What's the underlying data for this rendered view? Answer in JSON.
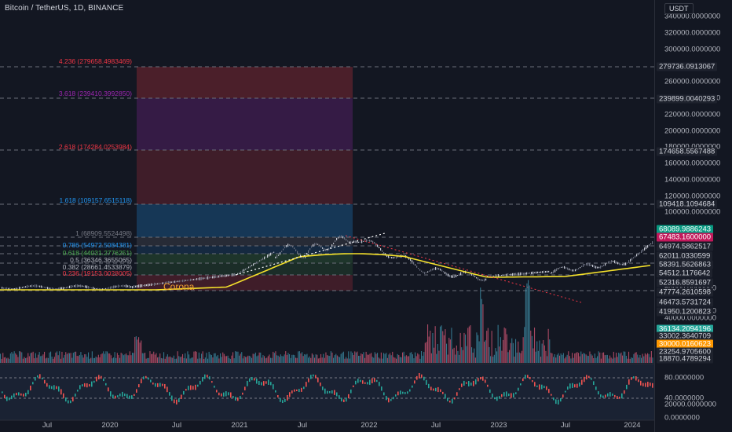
{
  "header": {
    "title": "Bitcoin / TetherUS, 1D, BINANCE",
    "currency_button": "USDT"
  },
  "annotation": {
    "text": "Corona",
    "color": "#f0a030"
  },
  "fib_levels": [
    {
      "label": "4.236 (279658.4983469)",
      "color": "#f23645"
    },
    {
      "label": "3.618 (239410.3992850)",
      "color": "#9c27b0"
    },
    {
      "label": "2.618 (174284.0253984)",
      "color": "#f23645"
    },
    {
      "label": "1.618 (109157.6515118)",
      "color": "#2196f3"
    },
    {
      "label": "1 (68909.5524498)",
      "color": "#787b86"
    },
    {
      "label": "0.786 (54972.5084381)",
      "color": "#2196f3"
    },
    {
      "label": "0.618 (44031.2776251)",
      "color": "#4caf50"
    },
    {
      "label": "0.5 (36346.3655065)",
      "color": "#b2b5be"
    },
    {
      "label": "0.382 (28661.4533879)",
      "color": "#b2b5be"
    },
    {
      "label": "0.236 (19153.0028005)",
      "color": "#f23645"
    }
  ],
  "price_axis": {
    "labels": [
      "340000.0000000",
      "320000.0000000",
      "300000.0000000",
      "260000.0000000",
      "240000.0000000",
      "220000.0000000",
      "200000.0000000",
      "180000.0000000",
      "160000.0000000",
      "140000.0000000",
      "120000.0000000",
      "100000.0000000",
      "50000.0000000",
      "45000.0000000",
      "40000.0000000",
      "20000.0000000"
    ],
    "badges": [
      {
        "text": "279736.0913067",
        "bg": "#1e222d",
        "fg": "#d1d4dc"
      },
      {
        "text": "239899.0040293",
        "bg": "#1e222d",
        "fg": "#d1d4dc"
      },
      {
        "text": "174658.5567488",
        "bg": "#1e222d",
        "fg": "#d1d4dc"
      },
      {
        "text": "109418.1094684",
        "bg": "#1e222d",
        "fg": "#d1d4dc"
      },
      {
        "text": "68089.9886243",
        "bg": "#089981",
        "fg": "#ffffff"
      },
      {
        "text": "67483.1600000",
        "bg": "#c2185b",
        "fg": "#ffffff"
      },
      {
        "text": "64974.5862517",
        "bg": "#1e222d",
        "fg": "#d1d4dc"
      },
      {
        "text": "62011.0330599",
        "bg": "#1e222d",
        "fg": "#d1d4dc"
      },
      {
        "text": "58391.5626863",
        "bg": "#1e222d",
        "fg": "#d1d4dc"
      },
      {
        "text": "54512.1176642",
        "bg": "#1e222d",
        "fg": "#d1d4dc"
      },
      {
        "text": "52316.8591697",
        "bg": "#1e222d",
        "fg": "#d1d4dc"
      },
      {
        "text": "47774.2610598",
        "bg": "#1e222d",
        "fg": "#d1d4dc"
      },
      {
        "text": "46473.5731724",
        "bg": "#1e222d",
        "fg": "#d1d4dc"
      },
      {
        "text": "41950.1200823",
        "bg": "#1e222d",
        "fg": "#d1d4dc"
      },
      {
        "text": "36134.2094196",
        "bg": "#26a69a",
        "fg": "#ffffff"
      },
      {
        "text": "33002.3640709",
        "bg": "#1e222d",
        "fg": "#d1d4dc"
      },
      {
        "text": "30000.0160623",
        "bg": "#ff9800",
        "fg": "#ffffff"
      },
      {
        "text": "23254.9705600",
        "bg": "#1e222d",
        "fg": "#d1d4dc"
      },
      {
        "text": "18870.4789294",
        "bg": "#1e222d",
        "fg": "#d1d4dc"
      }
    ],
    "oscillator_labels": [
      "80.0000000",
      "40.0000000",
      "0.0000000"
    ]
  },
  "time_axis": [
    "Jul",
    "2020",
    "Jul",
    "2021",
    "Jul",
    "2022",
    "Jul",
    "2023",
    "Jul",
    "2024"
  ]
}
